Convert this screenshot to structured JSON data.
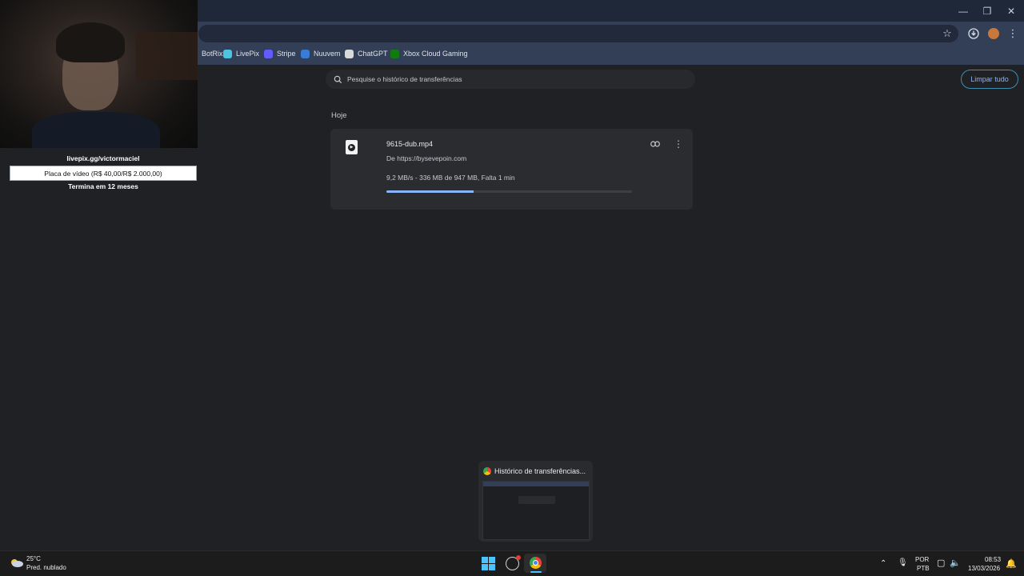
{
  "window": {
    "minimize_icon": "minimize-icon",
    "maximize_icon": "restore-icon",
    "close_icon": "close-icon"
  },
  "toolbar": {
    "star_icon": "star-icon",
    "download_icon": "download-icon",
    "menu_icon": "kebab-menu-icon"
  },
  "bookmarks": [
    {
      "label": "BotRix",
      "color": "#8a8f9a"
    },
    {
      "label": "LivePix",
      "color": "#4ec5e0"
    },
    {
      "label": "Stripe",
      "color": "#635bff"
    },
    {
      "label": "Nuuvem",
      "color": "#3a7bd5"
    },
    {
      "label": "ChatGPT",
      "color": "#d9d9d9"
    },
    {
      "label": "Xbox Cloud Gaming",
      "color": "#107c10"
    }
  ],
  "downloads": {
    "search_placeholder": "Pesquise o histórico de transferências",
    "clear_all": "Limpar tudo",
    "section": "Hoje",
    "items": [
      {
        "name": "9615-dub.mp4",
        "source": "De https://bysevepoin.com",
        "status": "9,2 MB/s - 336 MB de 947 MB, Falta 1 min",
        "progress": 0.355
      }
    ]
  },
  "overlay": {
    "url": "livepix.gg/victormaciel",
    "goal": "Placa de vídeo (R$ 40,00/R$ 2.000,00)",
    "goal_progress": 0.02,
    "ends": "Termina em 12 meses"
  },
  "taskbar_preview": {
    "title": "Histórico de transferências..."
  },
  "taskbar": {
    "weather_temp": "25°C",
    "weather_desc": "Pred. nublado",
    "lang": "POR",
    "layout": "PTB",
    "time": "08:53",
    "date": "13/03/2026"
  },
  "colors": {
    "accent": "#8ab4f8",
    "titlebar": "#1f2838",
    "toolbar": "#323f56",
    "background": "#202124"
  }
}
